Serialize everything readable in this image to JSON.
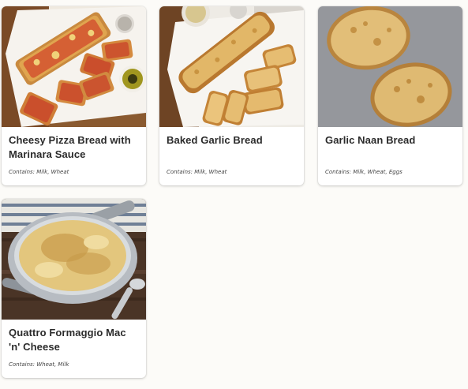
{
  "menu": {
    "items": [
      {
        "title": "Cheesy Pizza Bread with Marinara Sauce",
        "allergens": "Contains: Milk, Wheat",
        "image_icon": "pizza-bread-photo"
      },
      {
        "title": "Baked Garlic Bread",
        "allergens": "Contains: Milk, Wheat",
        "image_icon": "garlic-bread-photo"
      },
      {
        "title": "Garlic Naan Bread",
        "allergens": "Contains: Milk, Wheat, Eggs",
        "image_icon": "naan-bread-photo"
      },
      {
        "title": "Quattro Formaggio Mac 'n' Cheese",
        "allergens": "Contains: Wheat, Milk",
        "image_icon": "mac-and-cheese-photo"
      }
    ]
  },
  "colors": {
    "page_background": "#fcfbf8",
    "card_background": "#ffffff",
    "title_text": "#2b2b2b"
  }
}
